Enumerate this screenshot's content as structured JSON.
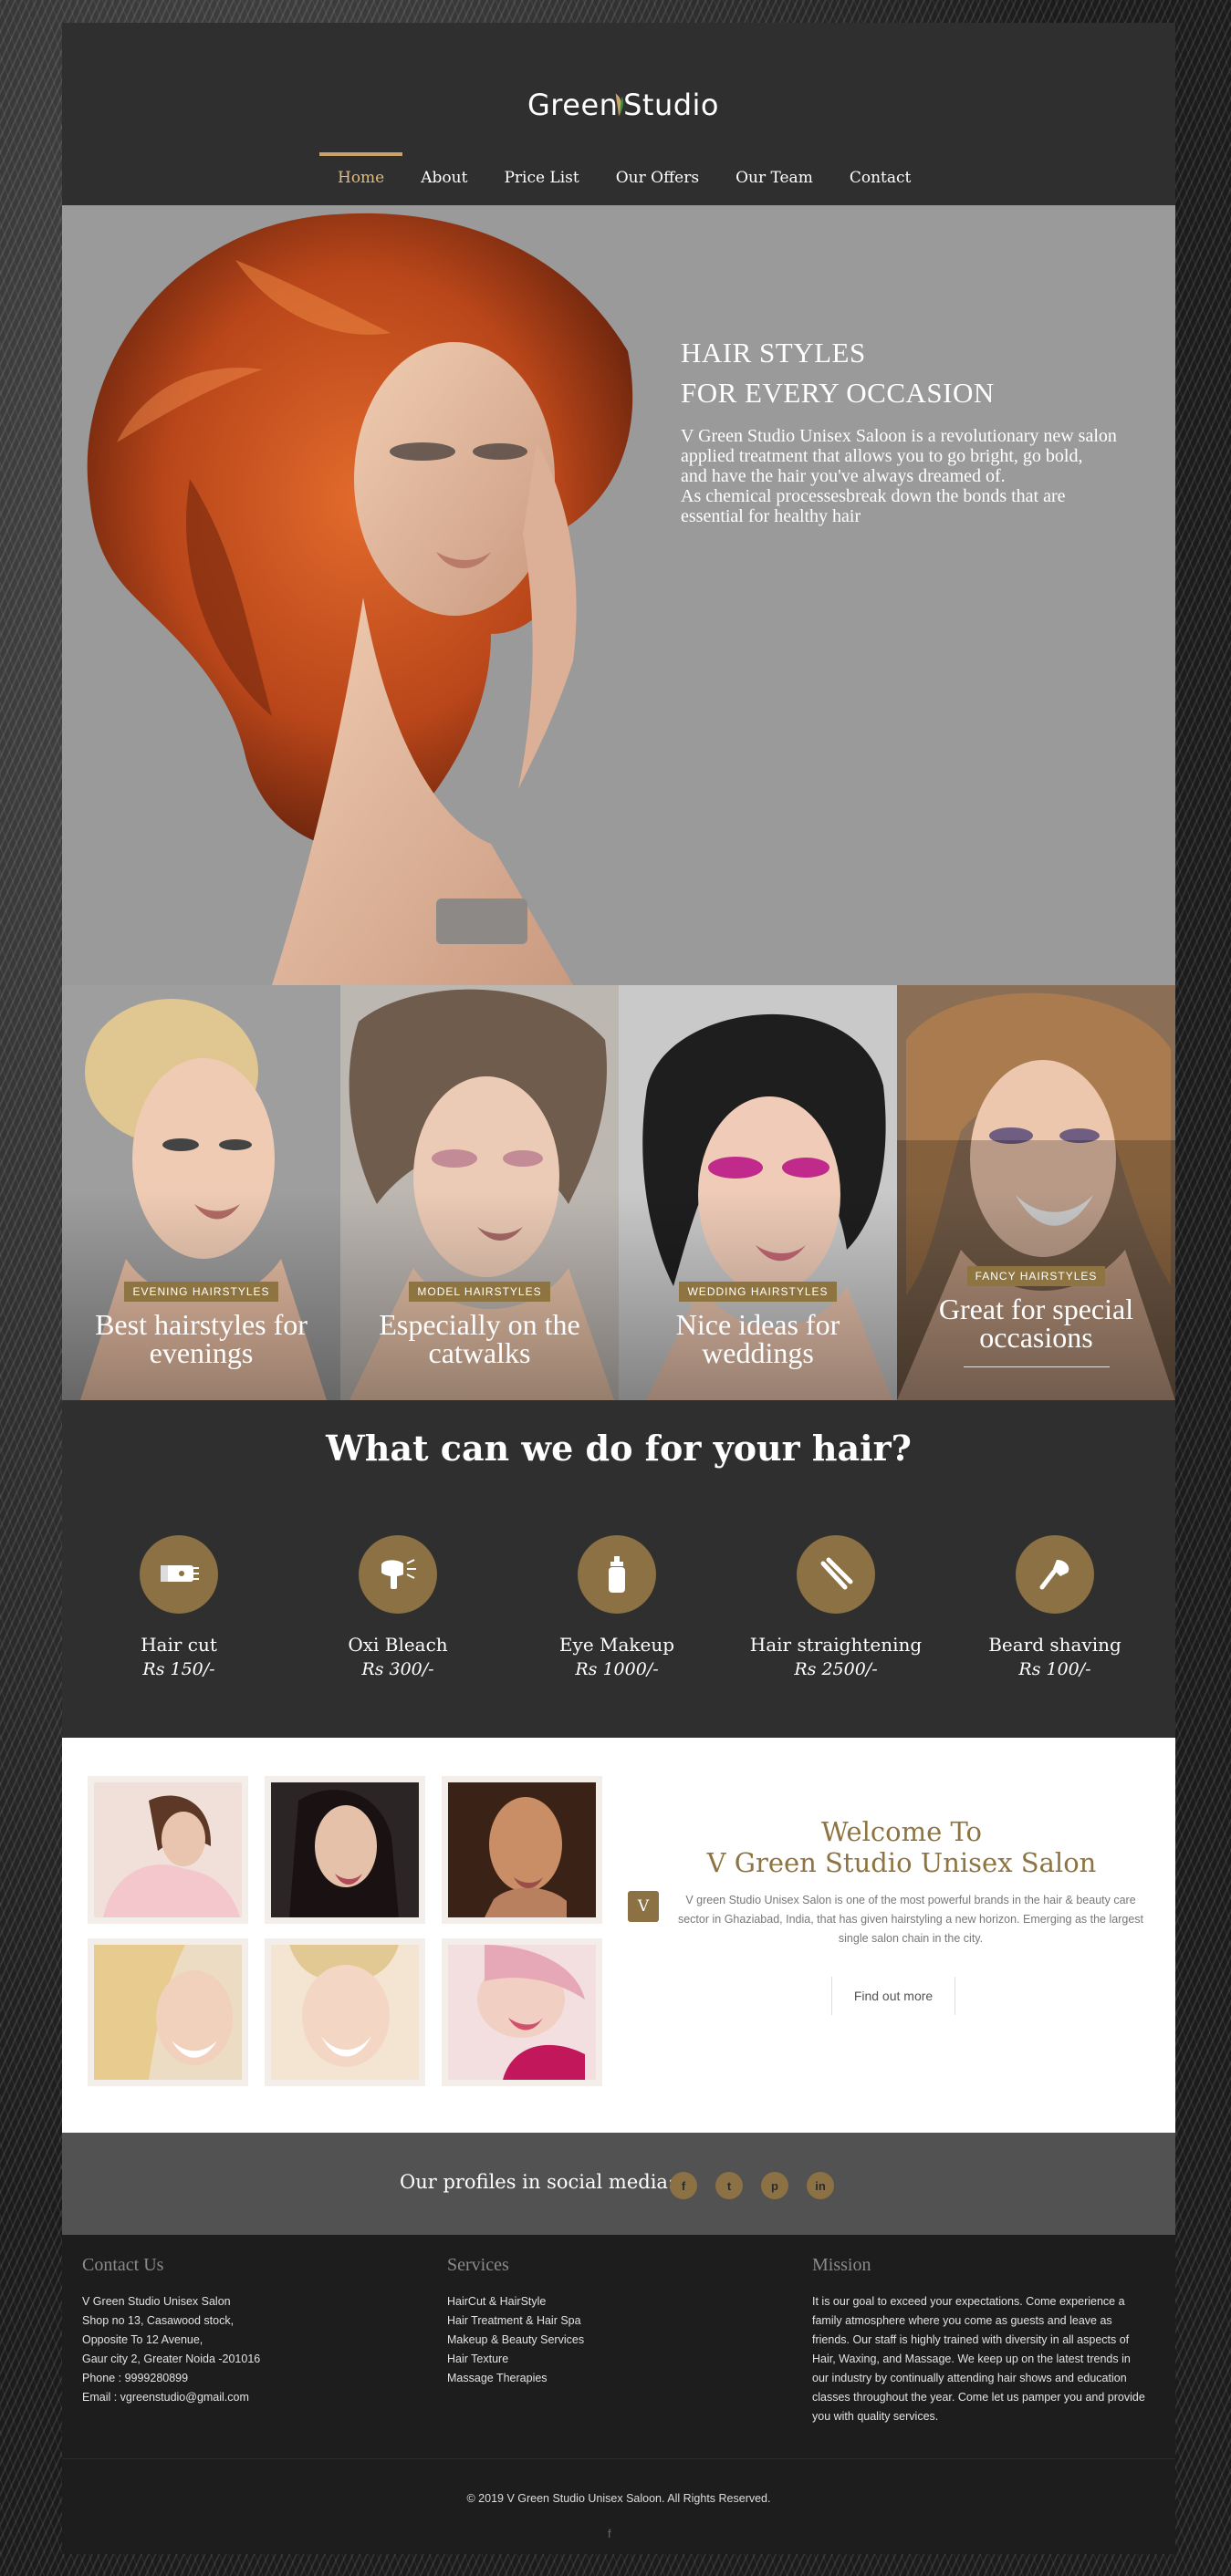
{
  "brand": {
    "logo_part1": "Green",
    "logo_part2": "Studio",
    "accent": "#8b7144",
    "accent_light": "#e2bb77"
  },
  "nav": {
    "items": [
      "Home",
      "About",
      "Price List",
      "Our Offers",
      "Our Team",
      "Contact"
    ],
    "active": "Home"
  },
  "hero": {
    "title_line1": "HAIR STYLES",
    "title_line2": "FOR EVERY OCCASION",
    "body_line1": "V Green Studio Unisex Saloon is a revolutionary new salon",
    "body_line2": "applied treatment that allows you to go bright, go bold,",
    "body_line3": "and have the hair you've always dreamed of.",
    "body_line4": "As chemical processesbreak down the bonds that are",
    "body_line5": "essential for healthy hair"
  },
  "tiles": [
    {
      "badge": "EVENING HAIRSTYLES",
      "title": "Best hairstyles for evenings"
    },
    {
      "badge": "MODEL HAIRSTYLES",
      "title": "Especially on the catwalks"
    },
    {
      "badge": "WEDDING HAIRSTYLES",
      "title": "Nice ideas for weddings"
    },
    {
      "badge": "FANCY HAIRSTYLES",
      "title": "Great for special occasions"
    }
  ],
  "services": {
    "title": "What can we do for your hair?",
    "items": [
      {
        "name": "Hair cut",
        "price": "Rs 150/-",
        "icon": "clipper-icon"
      },
      {
        "name": "Oxi Bleach",
        "price": "Rs 300/-",
        "icon": "hair-dryer-icon"
      },
      {
        "name": "Eye Makeup",
        "price": "Rs 1000/-",
        "icon": "cosmetic-bottle-icon"
      },
      {
        "name": "Hair straightening",
        "price": "Rs 2500/-",
        "icon": "flat-iron-icon"
      },
      {
        "name": "Beard shaving",
        "price": "Rs 100/-",
        "icon": "shaving-brush-icon"
      }
    ]
  },
  "welcome": {
    "title_line1": "Welcome To",
    "title_line2": "V Green Studio Unisex Salon",
    "badge": "V",
    "body": "V green Studio Unisex Salon is one of the most powerful brands in the hair & beauty care sector in Ghaziabad, India, that has given hairstyling a new horizon. Emerging as the largest single salon chain in the city.",
    "button": "Find out more"
  },
  "social": {
    "label": "Our profiles in social media:",
    "icons": [
      {
        "name": "facebook-icon",
        "glyph": "f"
      },
      {
        "name": "twitter-icon",
        "glyph": "t"
      },
      {
        "name": "pinterest-icon",
        "glyph": "p"
      },
      {
        "name": "linkedin-icon",
        "glyph": "in"
      }
    ]
  },
  "footer": {
    "contact": {
      "heading": "Contact Us",
      "lines": [
        "V Green Studio Unisex Salon",
        "Shop no 13, Casawood stock,",
        "Opposite To 12 Avenue,",
        "Gaur city 2, Greater Noida -201016",
        "Phone : 9999280899",
        "Email : vgreenstudio@gmail.com"
      ]
    },
    "services": {
      "heading": "Services",
      "links": [
        "HairCut & HairStyle",
        "Hair Treatment & Hair Spa",
        "Makeup & Beauty Services",
        "Hair Texture",
        "Massage Therapies"
      ]
    },
    "mission": {
      "heading": "Mission",
      "body": "It is our goal to exceed your expectations. Come experience a family atmosphere where you come as guests and leave as friends. Our staff is highly trained with diversity in all aspects of Hair, Waxing, and Massage. We keep up on the latest trends in our industry by continually attending hair shows and education classes throughout the year. Come let us pamper you and provide you with quality services."
    },
    "copyright": "© 2019 V Green Studio Unisex Saloon. All Rights Reserved.",
    "small_icon": "f"
  }
}
